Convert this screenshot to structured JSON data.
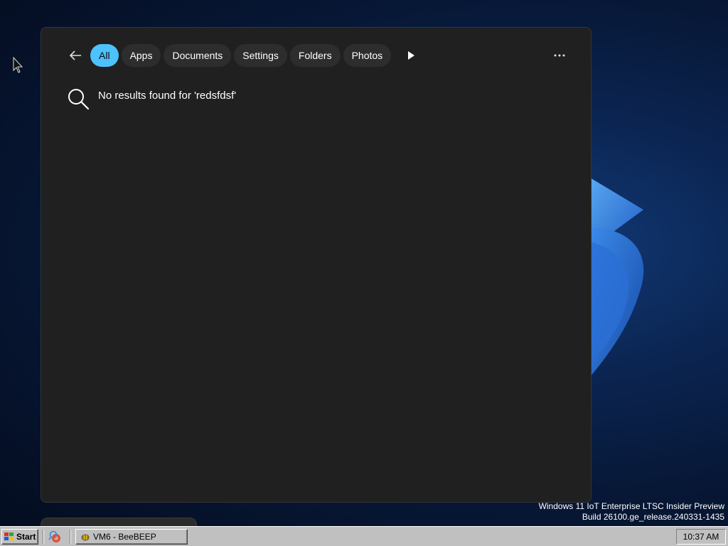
{
  "search_panel": {
    "filters": [
      {
        "label": "All",
        "active": true
      },
      {
        "label": "Apps",
        "active": false
      },
      {
        "label": "Documents",
        "active": false
      },
      {
        "label": "Settings",
        "active": false
      },
      {
        "label": "Folders",
        "active": false
      },
      {
        "label": "Photos",
        "active": false
      }
    ],
    "no_results_message": "No results found for 'redsfdsf'"
  },
  "watermark": {
    "line1": "Windows 11 IoT Enterprise LTSC Insider Preview",
    "line2": "Build 26100.ge_release.240331-1435"
  },
  "taskbar": {
    "start_label": "Start",
    "task_label": "VM6 - BeeBEEP",
    "clock": "10:37 AM"
  },
  "colors": {
    "accent": "#4cc2ff",
    "panel_bg": "#202020",
    "chip_bg": "#2d2d2d",
    "taskbar_bg": "#c0c0c0"
  },
  "icons": [
    "back-arrow-icon",
    "play-icon",
    "more-icon",
    "search-icon",
    "windows-logo-icon",
    "quick-launch-icon",
    "beebeep-icon",
    "mouse-cursor-icon"
  ]
}
